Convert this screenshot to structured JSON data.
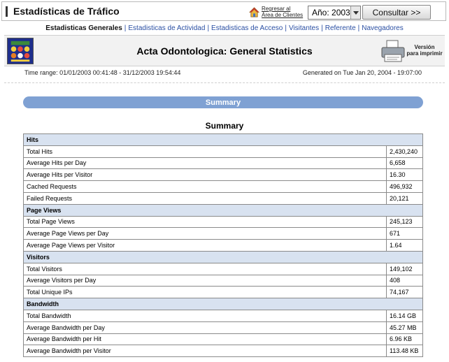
{
  "header": {
    "title": "Estadísticas de Tráfico",
    "return_link": "Regresar al\nÁrea de Clientes",
    "year_label": "Año:",
    "year_value": "2003",
    "consult_button": "Consultar >>"
  },
  "nav": {
    "items": [
      {
        "label": "Estadisticas Generales",
        "active": true
      },
      {
        "label": "Estadisticas de Actividad"
      },
      {
        "label": "Estadisticas de Acceso"
      },
      {
        "label": "Visitantes"
      },
      {
        "label": "Referente"
      },
      {
        "label": "Navegadores"
      }
    ],
    "separator": "|"
  },
  "report": {
    "title": "Acta Odontologica: General Statistics",
    "print_label": "Versión\npara imprimir",
    "time_range": "Time range: 01/01/2003 00:41:48 - 31/12/2003 19:54:44",
    "generated": "Generated on Tue Jan 20, 2004 - 19:07:00",
    "summary_bar": "Summary",
    "summary_heading": "Summary"
  },
  "sections": [
    {
      "name": "Hits",
      "rows": [
        {
          "label": "Total Hits",
          "value": "2,430,240"
        },
        {
          "label": "Average Hits per Day",
          "value": "6,658"
        },
        {
          "label": "Average Hits per Visitor",
          "value": "16.30"
        },
        {
          "label": "Cached Requests",
          "value": "496,932"
        },
        {
          "label": "Failed Requests",
          "value": "20,121"
        }
      ]
    },
    {
      "name": "Page Views",
      "rows": [
        {
          "label": "Total Page Views",
          "value": "245,123"
        },
        {
          "label": "Average Page Views per Day",
          "value": "671"
        },
        {
          "label": "Average Page Views per Visitor",
          "value": "1.64"
        }
      ]
    },
    {
      "name": "Visitors",
      "rows": [
        {
          "label": "Total Visitors",
          "value": "149,102"
        },
        {
          "label": "Average Visitors per Day",
          "value": "408"
        },
        {
          "label": "Total Unique IPs",
          "value": "74,167"
        }
      ]
    },
    {
      "name": "Bandwidth",
      "rows": [
        {
          "label": "Total Bandwidth",
          "value": "16.14 GB"
        },
        {
          "label": "Average Bandwidth per Day",
          "value": "45.27 MB"
        },
        {
          "label": "Average Bandwidth per Hit",
          "value": "6.96 KB"
        },
        {
          "label": "Average Bandwidth per Visitor",
          "value": "113.48 KB"
        }
      ]
    }
  ],
  "colors": {
    "summary_bar": "#7fa1d3",
    "section_row": "#d8e2f0",
    "nav_link": "#2a4fa3"
  },
  "icons": [
    "house-icon",
    "chevron-down-icon",
    "logo-icon",
    "printer-icon"
  ]
}
